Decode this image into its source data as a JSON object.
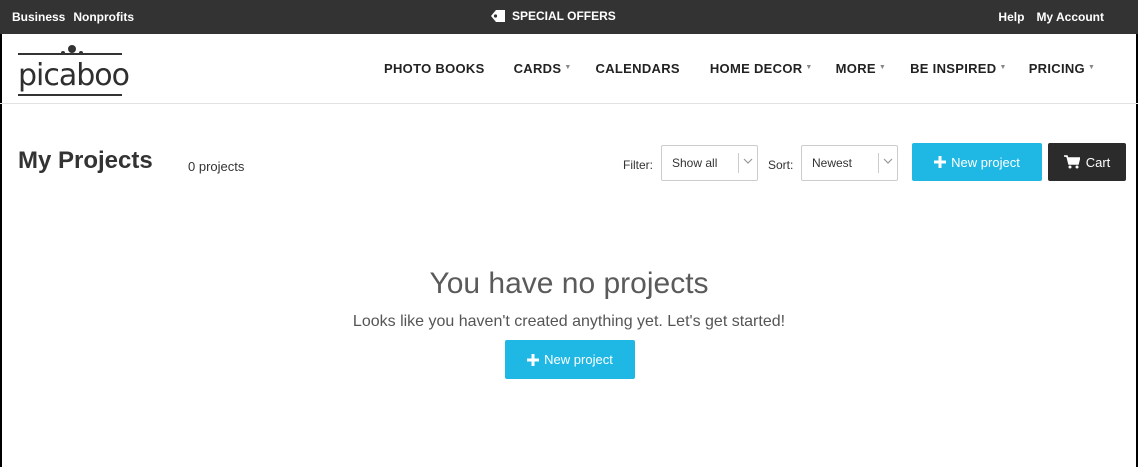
{
  "topbar": {
    "left_links": [
      "Business",
      "Nonprofits"
    ],
    "special_offers": "SPECIAL OFFERS",
    "right_links": [
      "Help",
      "My Account"
    ]
  },
  "header": {
    "logo_text": "picaboo",
    "nav": [
      {
        "label": "PHOTO BOOKS",
        "dropdown": false
      },
      {
        "label": "CARDS",
        "dropdown": true
      },
      {
        "label": "CALENDARS",
        "dropdown": false
      },
      {
        "label": "HOME DECOR",
        "dropdown": true
      },
      {
        "label": "MORE",
        "dropdown": true
      },
      {
        "label": "BE INSPIRED",
        "dropdown": true
      },
      {
        "label": "PRICING",
        "dropdown": true
      }
    ]
  },
  "toolbar": {
    "title": "My Projects",
    "count": "0 projects",
    "filter_label": "Filter:",
    "filter_value": "Show all",
    "sort_label": "Sort:",
    "sort_value": "Newest",
    "new_project_label": "New project",
    "cart_label": "Cart"
  },
  "empty_state": {
    "title": "You have no projects",
    "subtitle": "Looks like you haven't created anything yet. Let's get started!",
    "button_label": "New project"
  },
  "colors": {
    "topbar_bg": "#333333",
    "accent": "#1fb8e4",
    "cart_bg": "#2b2b2b"
  },
  "icons": [
    "tag-icon",
    "plus-icon",
    "cart-icon",
    "chevron-down-icon"
  ]
}
